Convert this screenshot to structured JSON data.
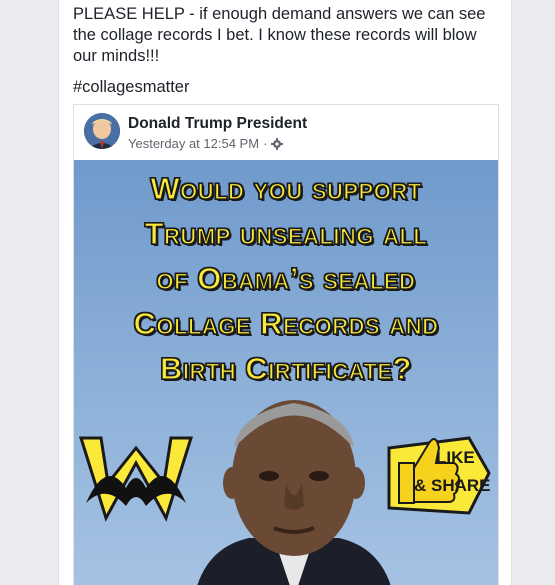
{
  "post": {
    "text": "PLEASE HELP - if enough demand answers we can see the collage records I bet. I know these records will blow our minds!!!",
    "hashtag": "#collagesmatter"
  },
  "shared_post": {
    "page_name": "Donald Trump President",
    "timestamp": "Yesterday at 12:54 PM",
    "separator": "·",
    "privacy_icon": "gear-icon",
    "image": {
      "headline_lines": [
        "Would you support",
        "Trump unsealing all",
        "of Obama’s sealed",
        "Collage Records and",
        "Birth Cirtificate?"
      ],
      "badge_line1": "LIKE",
      "badge_line2": "& SHARE",
      "text_color": "#fbe93a",
      "background_color": "#7fa6d3"
    }
  }
}
